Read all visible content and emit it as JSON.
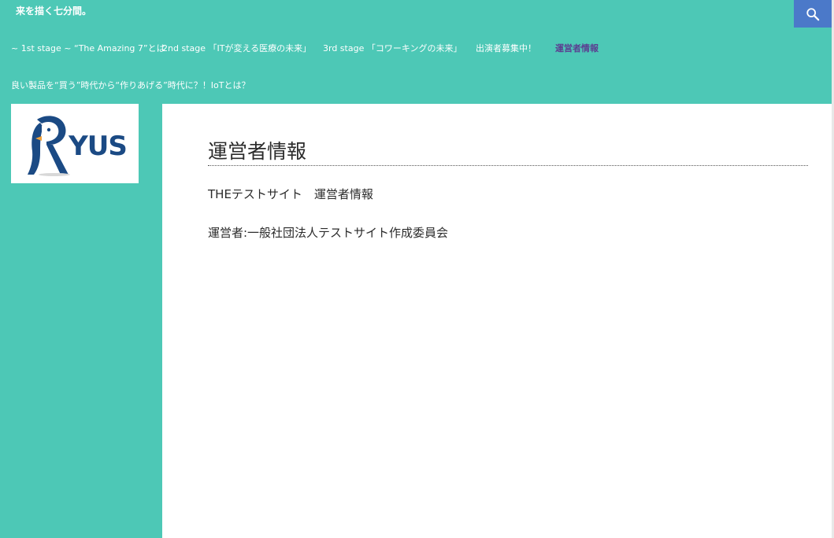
{
  "header": {
    "tagline": "来を描く七分間。",
    "search_icon": "search-icon"
  },
  "nav": {
    "items": [
      {
        "label": "~ 1st stage ~ “The Amazing 7”とは",
        "active": false
      },
      {
        "label": "2nd stage 「ITが変える医療の未来」",
        "active": false
      },
      {
        "label": "3rd stage 「コワーキングの未来」",
        "active": false
      },
      {
        "label": "出演者募集中！",
        "active": false
      },
      {
        "label": "運営者情報",
        "active": true
      },
      {
        "label": "良い製品を“買う”時代から“作りあげる”時代に？！IoTとは？",
        "active": false
      }
    ]
  },
  "sidebar": {
    "logo_text": "YUS"
  },
  "main": {
    "title": "運営者情報",
    "paragraphs": [
      "THEテストサイト　運営者情報",
      "運営者:一般社団法人テストサイト作成委員会"
    ]
  },
  "colors": {
    "background": "#4dc8b6",
    "search_button": "#4b79c9",
    "active_nav": "#5b3f91",
    "logo_blue": "#1b4a84",
    "logo_orange": "#f2a23a"
  }
}
